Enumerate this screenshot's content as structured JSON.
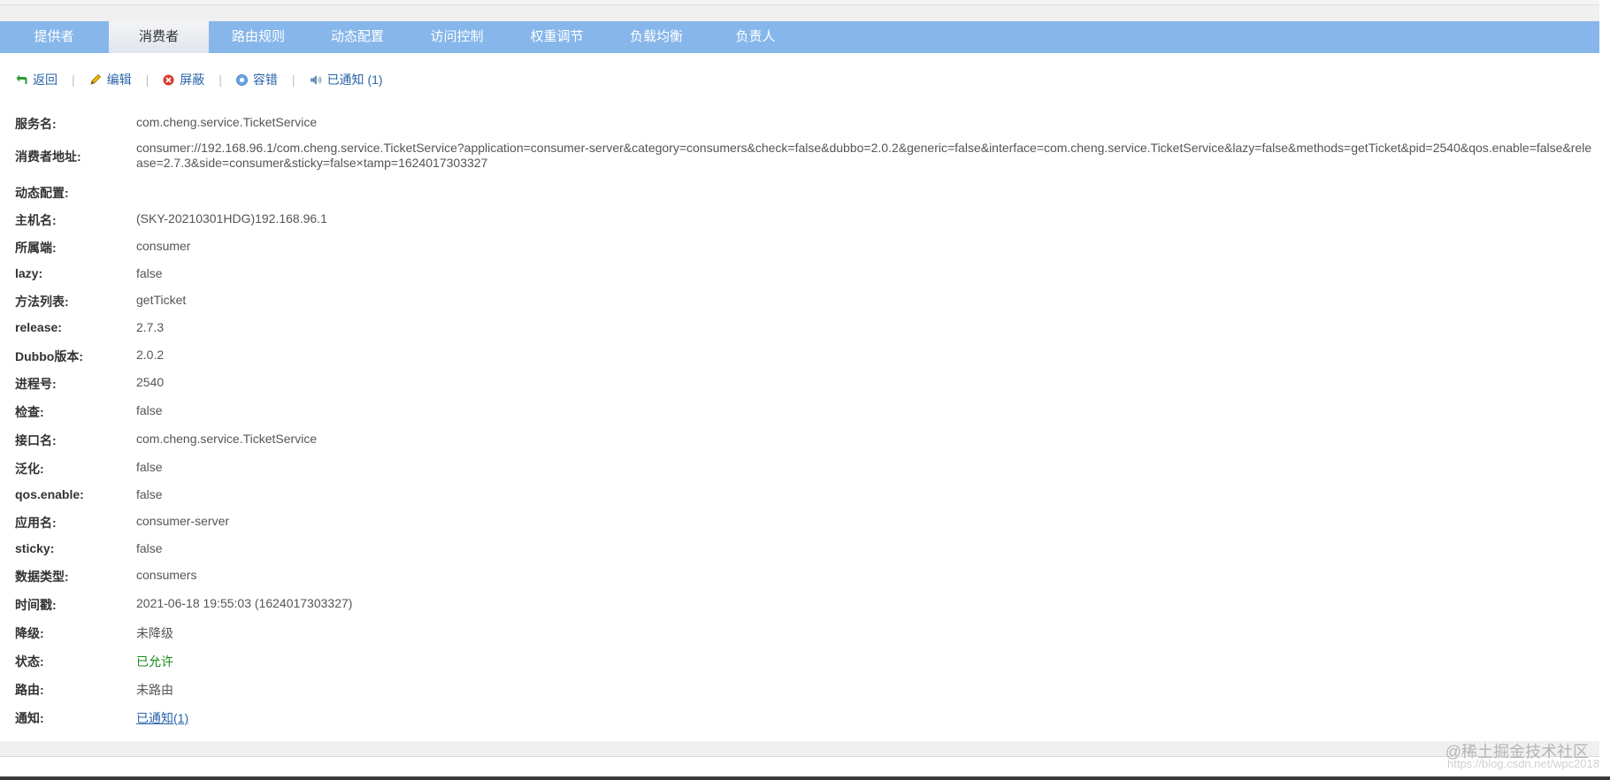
{
  "tabs": [
    {
      "label": "提供者",
      "active": false
    },
    {
      "label": "消费者",
      "active": true
    },
    {
      "label": "路由规则",
      "active": false
    },
    {
      "label": "动态配置",
      "active": false
    },
    {
      "label": "访问控制",
      "active": false
    },
    {
      "label": "权重调节",
      "active": false
    },
    {
      "label": "负载均衡",
      "active": false
    },
    {
      "label": "负责人",
      "active": false
    }
  ],
  "toolbar": {
    "back": "返回",
    "edit": "编辑",
    "shield": "屏蔽",
    "tolerance": "容错",
    "notified": "已通知 (1)",
    "separator": "|"
  },
  "details": [
    {
      "label": "服务名:",
      "value": "com.cheng.service.TicketService"
    },
    {
      "label": "消费者地址:",
      "value": "consumer://192.168.96.1/com.cheng.service.TicketService?application=consumer-server&category=consumers&check=false&dubbo=2.0.2&generic=false&interface=com.cheng.service.TicketService&lazy=false&methods=getTicket&pid=2540&qos.enable=false&release=2.7.3&side=consumer&sticky=false×tamp=1624017303327"
    },
    {
      "label": "动态配置:",
      "value": ""
    },
    {
      "label": "主机名:",
      "value": "(SKY-20210301HDG)192.168.96.1"
    },
    {
      "label": "所属端:",
      "value": "consumer"
    },
    {
      "label": "lazy:",
      "value": "false"
    },
    {
      "label": "方法列表:",
      "value": "getTicket"
    },
    {
      "label": "release:",
      "value": "2.7.3"
    },
    {
      "label": "Dubbo版本:",
      "value": "2.0.2"
    },
    {
      "label": "进程号:",
      "value": "2540"
    },
    {
      "label": "检查:",
      "value": "false"
    },
    {
      "label": "接口名:",
      "value": "com.cheng.service.TicketService"
    },
    {
      "label": "泛化:",
      "value": "false"
    },
    {
      "label": "qos.enable:",
      "value": "false"
    },
    {
      "label": "应用名:",
      "value": "consumer-server"
    },
    {
      "label": "sticky:",
      "value": "false"
    },
    {
      "label": "数据类型:",
      "value": "consumers"
    },
    {
      "label": "时间戳:",
      "value": "2021-06-18 19:55:03 (1624017303327)"
    },
    {
      "label": "降级:",
      "value": "未降级"
    },
    {
      "label": "状态:",
      "value": "已允许"
    },
    {
      "label": "路由:",
      "value": "未路由"
    },
    {
      "label": "通知:",
      "value": "已通知(1)"
    }
  ],
  "watermark": {
    "line1": "@稀土掘金技术社区",
    "line2": "https://blog.csdn.net/wpc2018"
  },
  "colors": {
    "tab_bar": "#86b6ea",
    "link": "#2a64a8",
    "status_ok": "#1a8a1a"
  }
}
